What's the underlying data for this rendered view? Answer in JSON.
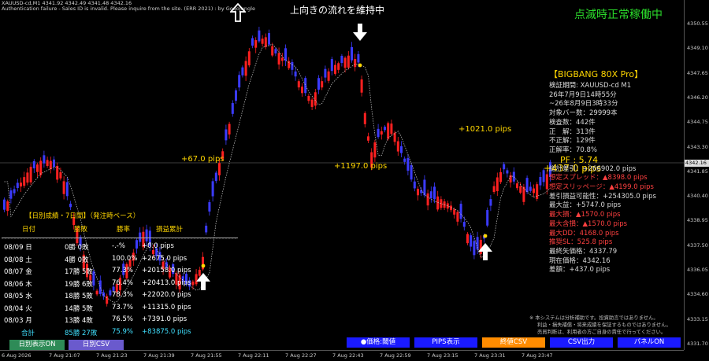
{
  "header": {
    "line1": "XAUUSD-cd,M1  4341.92 4342.49 4341.48 4342.16",
    "line2": "Authentication failure - Sales ID is invalid. Please inquire from the site. (ERR 2021) : by GogoJungle",
    "center_message": "上向きの流れを維持中",
    "status": "点滅時正常稼働中"
  },
  "price_axis": {
    "ticks": [
      "4350.55",
      "4349.10",
      "4347.65",
      "4346.20",
      "4344.75",
      "4343.30",
      "4341.85",
      "4340.40",
      "4338.95",
      "4337.50",
      "4336.05",
      "4334.60",
      "4333.15",
      "4331.70"
    ],
    "current": "4342.16"
  },
  "time_axis": {
    "labels": [
      "6 Aug 2026",
      "7 Aug 21:07",
      "7 Aug 21:23",
      "7 Aug 21:39",
      "7 Aug 21:55",
      "7 Aug 22:11",
      "7 Aug 22:27",
      "7 Aug 22:43",
      "7 Aug 22:59",
      "7 Aug 23:15",
      "7 Aug 23:31",
      "7 Aug 23:47"
    ]
  },
  "pips_labels": [
    "+67.0 pips",
    "+1197.0 pips",
    "+1021.0 pips",
    "+437.0 pips"
  ],
  "panel": {
    "title": "【BIGBANG 80X Pro】",
    "lines": [
      {
        "text": "検証期間:  XAUUSD-cd M1",
        "color": "#d8d8d8"
      },
      {
        "text": "26年7月9日14時55分",
        "color": "#d8d8d8"
      },
      {
        "text": "~26年8月9日3時33分",
        "color": "#d8d8d8"
      },
      {
        "text": "対象バー数：29999本",
        "color": "#d8d8d8"
      },
      {
        "text": "検査数：442件",
        "color": "#d8d8d8"
      },
      {
        "text": "正　解：313件",
        "color": "#d8d8d8"
      },
      {
        "text": "不正解：129件",
        "color": "#d8d8d8"
      },
      {
        "text": "正解率：70.8%",
        "color": "#d8d8d8"
      },
      {
        "text": "PF  : 5.74",
        "color": "#ffd700"
      },
      {
        "text": "総計差引：+266902.0 pips",
        "color": "#d8d8d8"
      },
      {
        "text": "想定スプレッド：▲8398.0 pips",
        "color": "#ff4040"
      },
      {
        "text": "想定スリッページ：▲4199.0 pips",
        "color": "#ff4040"
      },
      {
        "text": "差引損益可能性：+254305.0 pips",
        "color": "#d8d8d8"
      },
      {
        "text": "最大益：+5747.0 pips",
        "color": "#d8d8d8"
      },
      {
        "text": "最大損：▲1570.0 pips",
        "color": "#ff4040"
      },
      {
        "text": "最大含損：▲1570.0 pips",
        "color": "#ff4040"
      },
      {
        "text": "最大DD：4168.0 pips",
        "color": "#ff4040"
      },
      {
        "text": "推奨SL：525.8 pips",
        "color": "#ff4040"
      },
      {
        "text": "最終矢価格：4337.79",
        "color": "#d8d8d8"
      },
      {
        "text": "現在価格：4342.16",
        "color": "#d8d8d8"
      },
      {
        "text": "差額：+437.0 pips",
        "color": "#d8d8d8"
      }
    ],
    "notes": [
      "※ 本システムは分析補助です。投資助言ではありません。",
      "利益・損失補償・将来成績を保証するものではありません。",
      "売買判断は、利用者の方ご自身の責任で行ってください。"
    ]
  },
  "daily": {
    "title": "【日別成績・7日間】（発注時ベース）",
    "headers": [
      "日付",
      "勝敗",
      "勝率",
      "損益累計"
    ],
    "rows": [
      {
        "date": "08/09 日",
        "wl": "0勝 0敗",
        "rate": "-.-%",
        "pnl": "+0.0 pips",
        "color": "#ffffff"
      },
      {
        "date": "08/08 土",
        "wl": "4勝 0敗",
        "rate": "100.0%",
        "pnl": "+2675.0 pips",
        "color": "#ffffff"
      },
      {
        "date": "08/07 金",
        "wl": "17勝 5敗",
        "rate": "77.3%",
        "pnl": "+20158.0 pips",
        "color": "#ffffff"
      },
      {
        "date": "08/06 木",
        "wl": "19勝 6敗",
        "rate": "76.4%",
        "pnl": "+20413.0 pips",
        "color": "#ffffff"
      },
      {
        "date": "08/05 水",
        "wl": "18勝 5敗",
        "rate": "78.3%",
        "pnl": "+22020.0 pips",
        "color": "#ffffff"
      },
      {
        "date": "08/04 火",
        "wl": "14勝 5敗",
        "rate": "73.7%",
        "pnl": "+11315.0 pips",
        "color": "#ffffff"
      },
      {
        "date": "08/03 月",
        "wl": "13勝 4敗",
        "rate": "76.5%",
        "pnl": "+7391.0 pips",
        "color": "#ffffff"
      },
      {
        "date": "合計",
        "wl": "85勝 27敗",
        "rate": "75.9%",
        "pnl": "+83875.0 pips",
        "color": "#40e0ff"
      }
    ]
  },
  "buttons": {
    "left": [
      {
        "label": "日別表示ON",
        "bg": "#2e8b57"
      },
      {
        "label": "日別CSV",
        "bg": "#6a5acd"
      }
    ],
    "right": [
      {
        "label": "●価格:閾値",
        "bg": "#1a1aff"
      },
      {
        "label": "PIPS表示",
        "bg": "#1a1aff"
      },
      {
        "label": "終値CSV",
        "bg": "#ff8c00"
      },
      {
        "label": "CSV出力",
        "bg": "#1a1aff"
      },
      {
        "label": "パネルON",
        "bg": "#1a1aff"
      }
    ]
  },
  "colors": {
    "bull": "#3b3bff",
    "bear": "#ff2020",
    "ma": "#cccccc",
    "signal": "#ffd700",
    "background": "#000000"
  }
}
